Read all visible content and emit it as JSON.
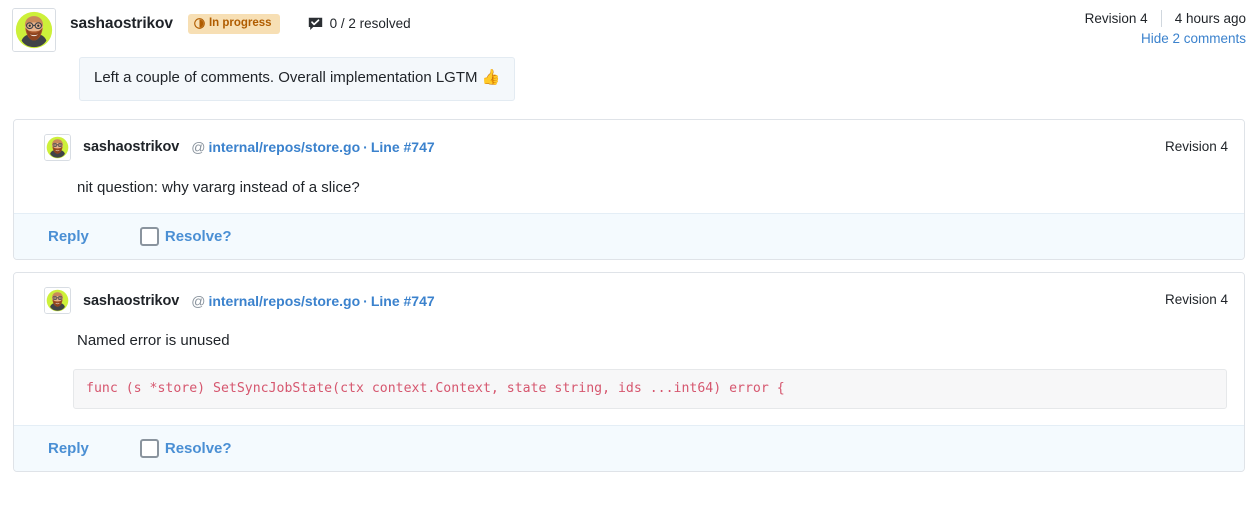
{
  "summary": {
    "author": "sashaostrikov",
    "avatar_icon": "user-avatar",
    "status_badge": {
      "label": "In progress",
      "icon": "clock-icon",
      "background": "#f7dfb4",
      "text_color": "#b05c00"
    },
    "resolved_icon": "comment-check-icon",
    "resolved_count": "0 / 2 resolved",
    "revision": "Revision 4",
    "timestamp": "4 hours ago",
    "hide_comments_link": "Hide 2 comments",
    "message": "Left a couple of comments. Overall implementation LGTM ",
    "message_emoji": "👍"
  },
  "comments": [
    {
      "author": "sashaostrikov",
      "avatar_icon": "user-avatar",
      "at_sign": "@",
      "file_path": "internal/repos/store.go",
      "separator": "·",
      "line_ref": "Line #747",
      "revision": "Revision 4",
      "text": "nit question: why vararg instead of a slice?",
      "code": null,
      "reply_label": "Reply",
      "resolve_label": "Resolve?",
      "resolve_checked": false
    },
    {
      "author": "sashaostrikov",
      "avatar_icon": "user-avatar",
      "at_sign": "@",
      "file_path": "internal/repos/store.go",
      "separator": "·",
      "line_ref": "Line #747",
      "revision": "Revision 4",
      "text": "Named error is unused",
      "code": "func (s *store) SetSyncJobState(ctx context.Context, state string, ids ...int64) error {",
      "reply_label": "Reply",
      "resolve_label": "Resolve?",
      "resolve_checked": false
    }
  ],
  "colors": {
    "link_blue": "#3b82cd",
    "action_blue": "#4a8fd4",
    "code_pink": "#d6576f",
    "footer_bg": "#f4fafe",
    "bubble_bg": "#f4f8fb"
  }
}
